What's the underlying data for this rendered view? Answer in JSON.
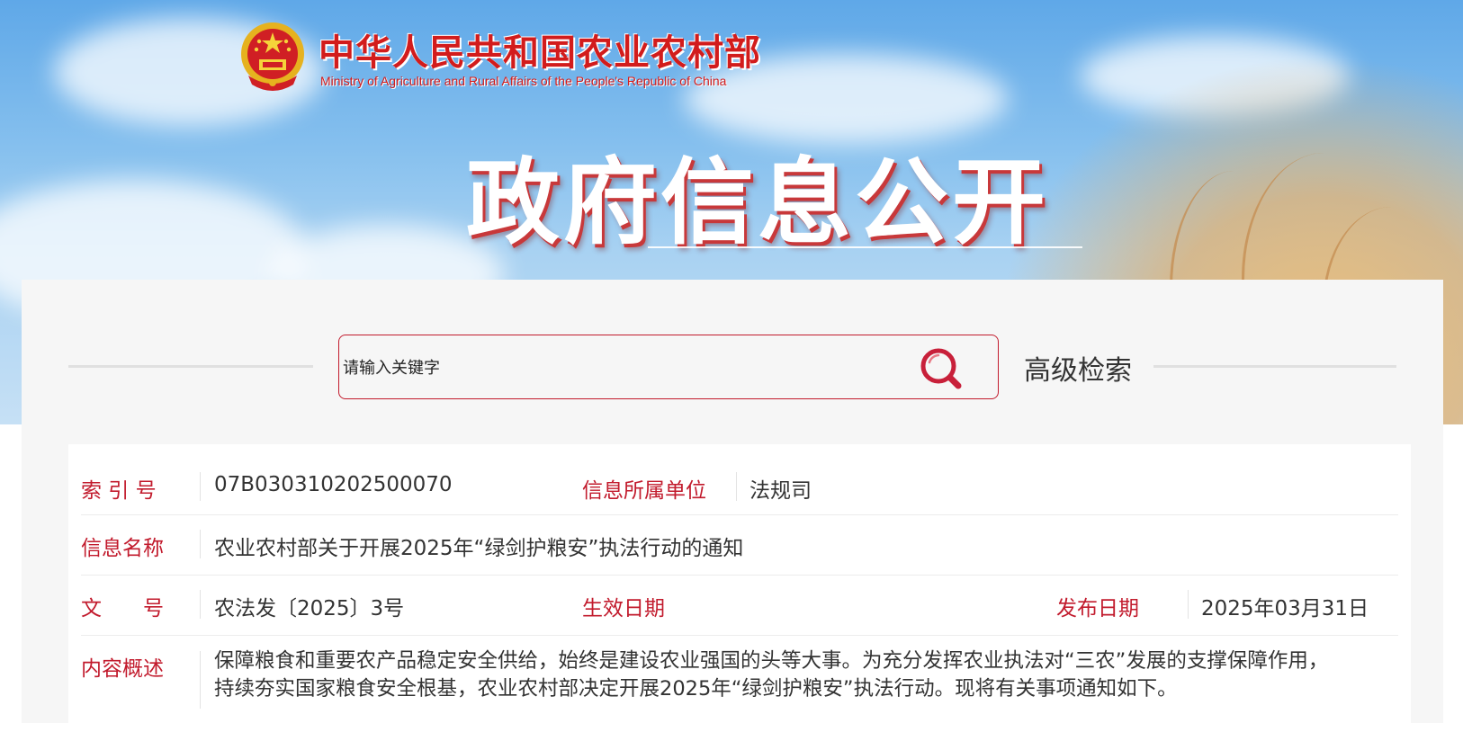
{
  "header": {
    "site_title_zh": "中华人民共和国农业农村部",
    "site_title_en": "Ministry of Agriculture and Rural Affairs of the People's Republic of China",
    "banner_title": "政府信息公开",
    "emblem_icon": "national-emblem-icon"
  },
  "search": {
    "placeholder": "请输入关键字",
    "value": "",
    "search_icon": "magnifier-icon",
    "advanced_label": "高级检索"
  },
  "info": {
    "index_label": "索 引 号",
    "index_value": "07B030310202500070",
    "unit_label": "信息所属单位",
    "unit_value": "法规司",
    "name_label": "信息名称",
    "name_value": "农业农村部关于开展2025年“绿剑护粮安”执法行动的通知",
    "doc_no_label": "文　　号",
    "doc_no_value": "农法发〔2025〕3号",
    "effective_label": "生效日期",
    "effective_value": "",
    "publish_label": "发布日期",
    "publish_value": "2025年03月31日",
    "summary_label": "内容概述",
    "summary_line1": "保障粮食和重要农产品稳定安全供给，始终是建设农业强国的头等大事。为充分发挥农业执法对“三农”发展的支撑保障作用，",
    "summary_line2": "持续夯实国家粮食安全根基，农业农村部决定开展2025年“绿剑护粮安”执法行动。现将有关事项通知如下。"
  },
  "colors": {
    "accent_red": "#c21b2d",
    "title_red": "#d21c1c",
    "panel_bg": "#f6f6f6"
  }
}
